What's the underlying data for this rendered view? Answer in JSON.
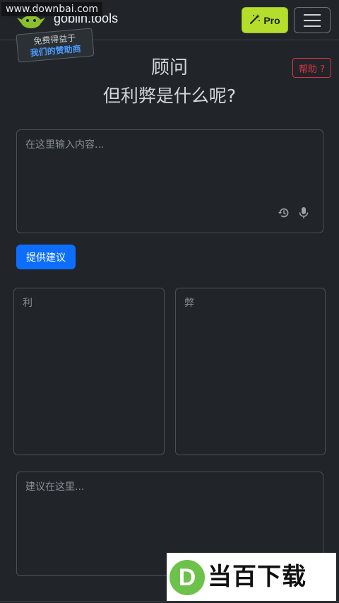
{
  "watermark": "www.downbai.com",
  "header": {
    "brand": "goblin.tools",
    "pro_label": "Pro",
    "sponsor_line1": "免费得益于",
    "sponsor_line2": "我们的赞助商"
  },
  "help_label": "帮助 ?",
  "page": {
    "title": "顾问",
    "subtitle": "但利弊是什么呢?"
  },
  "input": {
    "placeholder": "在这里输入内容..."
  },
  "submit_label": "提供建议",
  "pros_label": "利",
  "cons_label": "弊",
  "suggestion_placeholder": "建议在这里...",
  "badge": {
    "logo_letter": "D",
    "text": "当百下载"
  },
  "colors": {
    "background": "#212529",
    "pro_button": "#b5dd2c",
    "primary": "#0d6efd",
    "help": "#dc3545",
    "sponsor_link": "#4a9bff"
  },
  "icons": [
    "goblin-logo-icon",
    "magic-wand-icon",
    "hamburger-menu-icon",
    "history-icon",
    "microphone-icon"
  ]
}
